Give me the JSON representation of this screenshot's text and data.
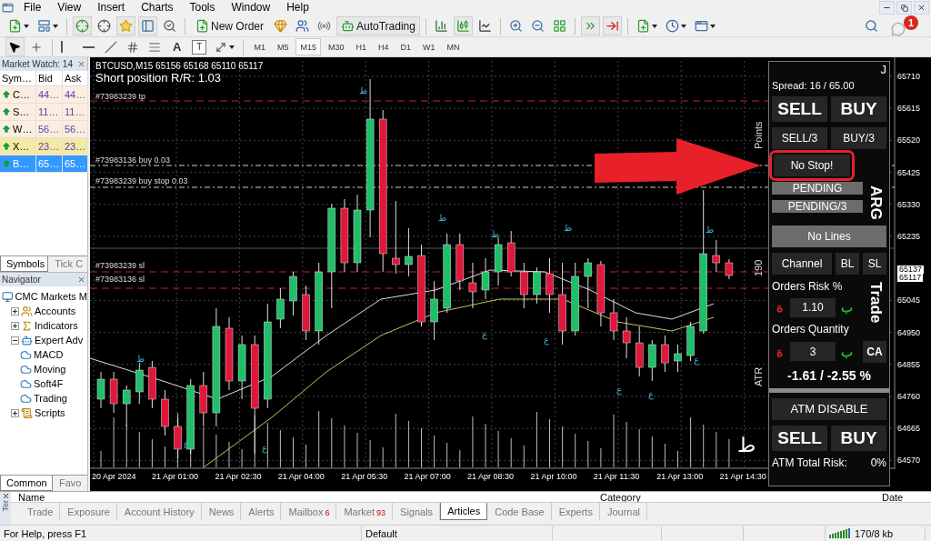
{
  "menu": [
    "File",
    "View",
    "Insert",
    "Charts",
    "Tools",
    "Window",
    "Help"
  ],
  "notifications": {
    "badge": "1"
  },
  "toolbar": {
    "new_order": "New Order",
    "autotrading": "AutoTrading"
  },
  "drawing_toolbar": {
    "text_tool": "A",
    "label_tool": "T",
    "periods": [
      {
        "label": "M1",
        "selected": false
      },
      {
        "label": "M5",
        "selected": false
      },
      {
        "label": "M15",
        "selected": true
      },
      {
        "label": "M30",
        "selected": false
      },
      {
        "label": "H1",
        "selected": false
      },
      {
        "label": "H4",
        "selected": false
      },
      {
        "label": "D1",
        "selected": false
      },
      {
        "label": "W1",
        "selected": false
      },
      {
        "label": "MN",
        "selected": false
      }
    ]
  },
  "market_watch": {
    "title": "Market Watch: 14",
    "columns": [
      "Sym…",
      "Bid",
      "Ask"
    ],
    "rows": [
      {
        "symbol": "C…",
        "bid": "44…",
        "ask": "44…",
        "highlighted": false,
        "selected": false
      },
      {
        "symbol": "S…",
        "bid": "11…",
        "ask": "11…",
        "highlighted": false,
        "selected": false
      },
      {
        "symbol": "W…",
        "bid": "56…",
        "ask": "56…",
        "highlighted": false,
        "selected": false
      },
      {
        "symbol": "X…",
        "bid": "23…",
        "ask": "23…",
        "highlighted": true,
        "selected": false
      },
      {
        "symbol": "B…",
        "bid": "65…",
        "ask": "65…",
        "highlighted": false,
        "selected": true
      }
    ],
    "tabs": [
      {
        "label": "Symbols",
        "selected": true
      },
      {
        "label": "Tick C",
        "selected": false
      }
    ]
  },
  "navigator": {
    "title": "Navigator",
    "tree": [
      {
        "label": "CMC Markets M",
        "kind": "broker",
        "children": [
          {
            "label": "Accounts",
            "kind": "accounts",
            "expanded": false
          },
          {
            "label": "Indicators",
            "kind": "indicators",
            "expanded": false
          },
          {
            "label": "Expert Adv",
            "kind": "experts",
            "expanded": true,
            "children": [
              {
                "label": "MACD",
                "kind": "expert"
              },
              {
                "label": "Moving",
                "kind": "expert"
              },
              {
                "label": "Soft4F",
                "kind": "expert"
              },
              {
                "label": "Trading",
                "kind": "expert"
              }
            ]
          },
          {
            "label": "Scripts",
            "kind": "scripts",
            "expanded": false
          }
        ]
      }
    ],
    "tabs": [
      {
        "label": "Common",
        "selected": true
      },
      {
        "label": "Favo",
        "selected": false
      }
    ]
  },
  "chart": {
    "header": "BTCUSD,M15  65156 65168 65110 65117",
    "position_note": "Short position R/R: 1.03",
    "order_lines": [
      {
        "label": "#73983239 tp",
        "kind": "tp"
      },
      {
        "label": "#73983136 buy 0.03",
        "kind": "entry"
      },
      {
        "label": "#73983239 buy stop 0.03",
        "kind": "entry"
      },
      {
        "label": "#73983239 sl",
        "kind": "sl"
      },
      {
        "label": "#73983136 sl",
        "kind": "sl"
      }
    ],
    "price_axis": [
      "65710",
      "65615",
      "65520",
      "65425",
      "65330",
      "65235",
      "65045",
      "64950",
      "64855",
      "64760",
      "64665",
      "64570"
    ],
    "price_tags": [
      "65137",
      "65117"
    ],
    "time_axis": [
      "20 Apr 2024",
      "21 Apr 01:00",
      "21 Apr 02:30",
      "21 Apr 04:00",
      "21 Apr 05:30",
      "21 Apr 07:00",
      "21 Apr 08:30",
      "21 Apr 10:00",
      "21 Apr 11:30",
      "21 Apr 13:00",
      "21 Apr 14:30"
    ],
    "side_labels": [
      "Points",
      "190",
      "ATR"
    ],
    "fractals": [
      {
        "kind": "up",
        "text": "ط"
      },
      {
        "kind": "up",
        "text": "ط"
      },
      {
        "kind": "up",
        "text": "ط"
      },
      {
        "kind": "up",
        "text": "ط"
      },
      {
        "kind": "up",
        "text": "ط"
      },
      {
        "kind": "up",
        "text": "ط"
      },
      {
        "kind": "down",
        "text": "ع"
      },
      {
        "kind": "down",
        "text": "ع"
      },
      {
        "kind": "down",
        "text": "ع"
      },
      {
        "kind": "down",
        "text": "ع"
      },
      {
        "kind": "down",
        "text": "ع"
      },
      {
        "kind": "down",
        "text": "ع"
      },
      {
        "kind": "down",
        "text": "ع"
      }
    ],
    "corner_glyph": "ط"
  },
  "trade_panel": {
    "corner": "J",
    "spread": "Spread: 16 / 65.00",
    "sell": "SELL",
    "buy": "BUY",
    "sell_third": "SELL/3",
    "buy_third": "BUY/3",
    "no_stop": "No Stop!",
    "pending": "PENDING",
    "pending_third": "PENDING/3",
    "arg": "ARG",
    "no_lines": "No Lines",
    "channel": "Channel",
    "bl": "BL",
    "sl": "SL",
    "trade": "Trade",
    "risk_label": "Orders Risk %",
    "risk_minus": "ة",
    "risk_value": "1.10",
    "risk_plus": "ب",
    "qty_label": "Orders Quantity",
    "qty_minus": "ة",
    "qty_value": "3",
    "qty_plus": "ب",
    "ca": "CA",
    "result": "-1.61 / -2.55 %",
    "atm": "ATM DISABLE",
    "atm_sell": "SELL",
    "atm_buy": "BUY",
    "atm_risk_label": "ATM Total Risk:",
    "atm_risk_value": "0%"
  },
  "terminal": {
    "side_label": "Ter",
    "columns": [
      "Name",
      "Category",
      "Date"
    ],
    "tabs": [
      {
        "label": "Trade",
        "selected": false
      },
      {
        "label": "Exposure",
        "selected": false
      },
      {
        "label": "Account History",
        "selected": false
      },
      {
        "label": "News",
        "selected": false
      },
      {
        "label": "Alerts",
        "selected": false
      },
      {
        "label": "Mailbox",
        "badge": "6",
        "selected": false
      },
      {
        "label": "Market",
        "badge": "93",
        "selected": false
      },
      {
        "label": "Signals",
        "selected": false
      },
      {
        "label": "Articles",
        "selected": true
      },
      {
        "label": "Code Base",
        "selected": false
      },
      {
        "label": "Experts",
        "selected": false
      },
      {
        "label": "Journal",
        "selected": false
      }
    ]
  },
  "status_bar": {
    "help": "For Help, press F1",
    "profile": "Default",
    "traffic": "170/8 kb"
  }
}
